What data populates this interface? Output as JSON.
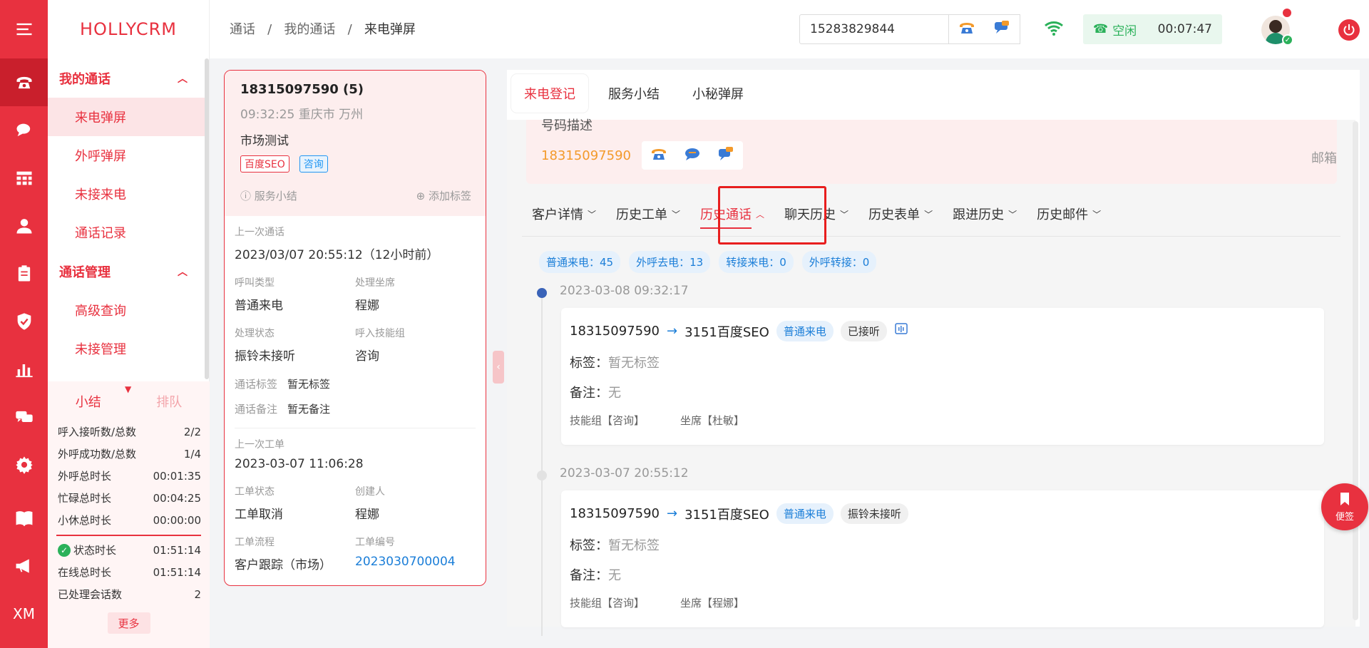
{
  "brand": "HOLLYCRM",
  "rail": {
    "icons": [
      "menu-icon",
      "phone-icon",
      "chat-icon",
      "grid-icon",
      "user-icon",
      "clipboard-icon",
      "shield-icon",
      "bar-chart-icon",
      "message-icon",
      "gear-icon",
      "book-icon",
      "megaphone-icon"
    ],
    "xm": "XM"
  },
  "sidebar": {
    "group1": "我的通话",
    "group1_items": [
      "来电弹屏",
      "外呼弹屏",
      "未接来电",
      "通话记录"
    ],
    "group2": "通话管理",
    "group2_items": [
      "高级查询",
      "未接管理"
    ]
  },
  "stats": {
    "tab1": "小结",
    "tab2": "排队",
    "rows": [
      {
        "k": "呼入接听数/总数",
        "v": "2/2"
      },
      {
        "k": "外呼成功数/总数",
        "v": "1/4"
      },
      {
        "k": "外呼总时长",
        "v": "00:01:35"
      },
      {
        "k": "忙碌总时长",
        "v": "00:04:25"
      },
      {
        "k": "小休总时长",
        "v": "00:00:00"
      }
    ],
    "rows2": [
      {
        "k": "状态时长",
        "v": "01:51:14"
      },
      {
        "k": "在线总时长",
        "v": "01:51:14"
      },
      {
        "k": "已处理会话数",
        "v": "2"
      }
    ],
    "more": "更多"
  },
  "topbar": {
    "breadcrumb": [
      "通话",
      "我的通话",
      "来电弹屏"
    ],
    "phone": "15283829844",
    "status": "空闲",
    "timer": "00:07:47"
  },
  "card": {
    "number": "18315097590 (5)",
    "time_loc": "09:32:25 重庆市 万州",
    "market": "市场测试",
    "tag1": "百度SEO",
    "tag2": "咨询",
    "summary": "服务小结",
    "add_tag": "添加标签",
    "last_call_label": "上一次通话",
    "last_call": "2023/03/07 20:55:12（12小时前）",
    "call_type_label": "呼叫类型",
    "call_type": "普通来电",
    "agent_label": "处理坐席",
    "agent": "程娜",
    "status_label": "处理状态",
    "status": "振铃未接听",
    "skill_label": "呼入技能组",
    "skill": "咨询",
    "tag_label": "通话标签",
    "tag_value": "暂无标签",
    "note_label": "通话备注",
    "note_value": "暂无备注",
    "last_ticket_label": "上一次工单",
    "last_ticket": "2023-03-07 11:06:28",
    "ticket_status_label": "工单状态",
    "ticket_status": "工单取消",
    "creator_label": "创建人",
    "creator": "程娜",
    "flow_label": "工单流程",
    "flow": "客户跟踪（市场）",
    "ticket_no_label": "工单编号",
    "ticket_no": "2023030700004"
  },
  "panel": {
    "tabs": [
      "来电登记",
      "服务小结",
      "小秘弹屏"
    ],
    "num_desc_title": "号码描述",
    "num": "18315097590",
    "mail": "邮箱",
    "sub_tabs": [
      "客户详情",
      "历史工单",
      "历史通话",
      "聊天历史",
      "历史表单",
      "跟进历史",
      "历史邮件"
    ],
    "counts": [
      "普通来电：45",
      "外呼去电：13",
      "转接来电：0",
      "外呼转接：0"
    ],
    "records": [
      {
        "time": "2023-03-08 09:32:17",
        "from": "18315097590",
        "to": "3151百度SEO",
        "type": "普通来电",
        "result": "已接听",
        "tag_k": "标签：",
        "tag_v": "暂无标签",
        "note_k": "备注：",
        "note_v": "无",
        "skill": "技能组【咨询】",
        "agent": "坐席【杜敏】"
      },
      {
        "time": "2023-03-07 20:55:12",
        "from": "18315097590",
        "to": "3151百度SEO",
        "type": "普通来电",
        "result": "振铃未接听",
        "tag_k": "标签：",
        "tag_v": "暂无标签",
        "note_k": "备注：",
        "note_v": "无",
        "skill": "技能组【咨询】",
        "agent": "坐席【程娜】"
      }
    ]
  },
  "memo": "便签",
  "colors": {
    "accent": "#e8313f",
    "link": "#1b7ed8",
    "success": "#2bb15a",
    "number_orange": "#f39a2b"
  }
}
